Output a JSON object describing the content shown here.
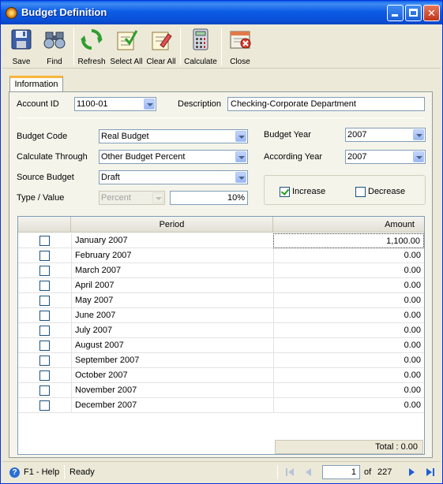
{
  "window": {
    "title": "Budget Definition"
  },
  "toolbar": {
    "save": "Save",
    "find": "Find",
    "refresh": "Refresh",
    "select_all": "Select All",
    "clear_all": "Clear All",
    "calculate": "Calculate",
    "close": "Close"
  },
  "tab": {
    "label": "Information"
  },
  "form": {
    "account_id_label": "Account ID",
    "account_id": "1100-01",
    "description_label": "Description",
    "description": "Checking-Corporate Department",
    "budget_code_label": "Budget Code",
    "budget_code": "Real Budget",
    "calculate_through_label": "Calculate Through",
    "calculate_through": "Other Budget Percent",
    "source_budget_label": "Source Budget",
    "source_budget": "Draft",
    "type_value_label": "Type / Value",
    "type": "Percent",
    "value": "10%",
    "budget_year_label": "Budget Year",
    "budget_year": "2007",
    "according_year_label": "According Year",
    "according_year": "2007",
    "increase_label": "Increase",
    "increase_checked": true,
    "decrease_label": "Decrease",
    "decrease_checked": false
  },
  "grid": {
    "columns": {
      "period": "Period",
      "amount": "Amount"
    },
    "rows": [
      {
        "period": "January 2007",
        "amount": "1,100.00"
      },
      {
        "period": "February 2007",
        "amount": "0.00"
      },
      {
        "period": "March 2007",
        "amount": "0.00"
      },
      {
        "period": "April 2007",
        "amount": "0.00"
      },
      {
        "period": "May 2007",
        "amount": "0.00"
      },
      {
        "period": "June 2007",
        "amount": "0.00"
      },
      {
        "period": "July 2007",
        "amount": "0.00"
      },
      {
        "period": "August 2007",
        "amount": "0.00"
      },
      {
        "period": "September 2007",
        "amount": "0.00"
      },
      {
        "period": "October 2007",
        "amount": "0.00"
      },
      {
        "period": "November 2007",
        "amount": "0.00"
      },
      {
        "period": "December 2007",
        "amount": "0.00"
      }
    ],
    "total": "Total : 0.00"
  },
  "status": {
    "help": "F1 - Help",
    "state": "Ready",
    "page": "1",
    "of_label": "of",
    "total_pages": "227"
  }
}
